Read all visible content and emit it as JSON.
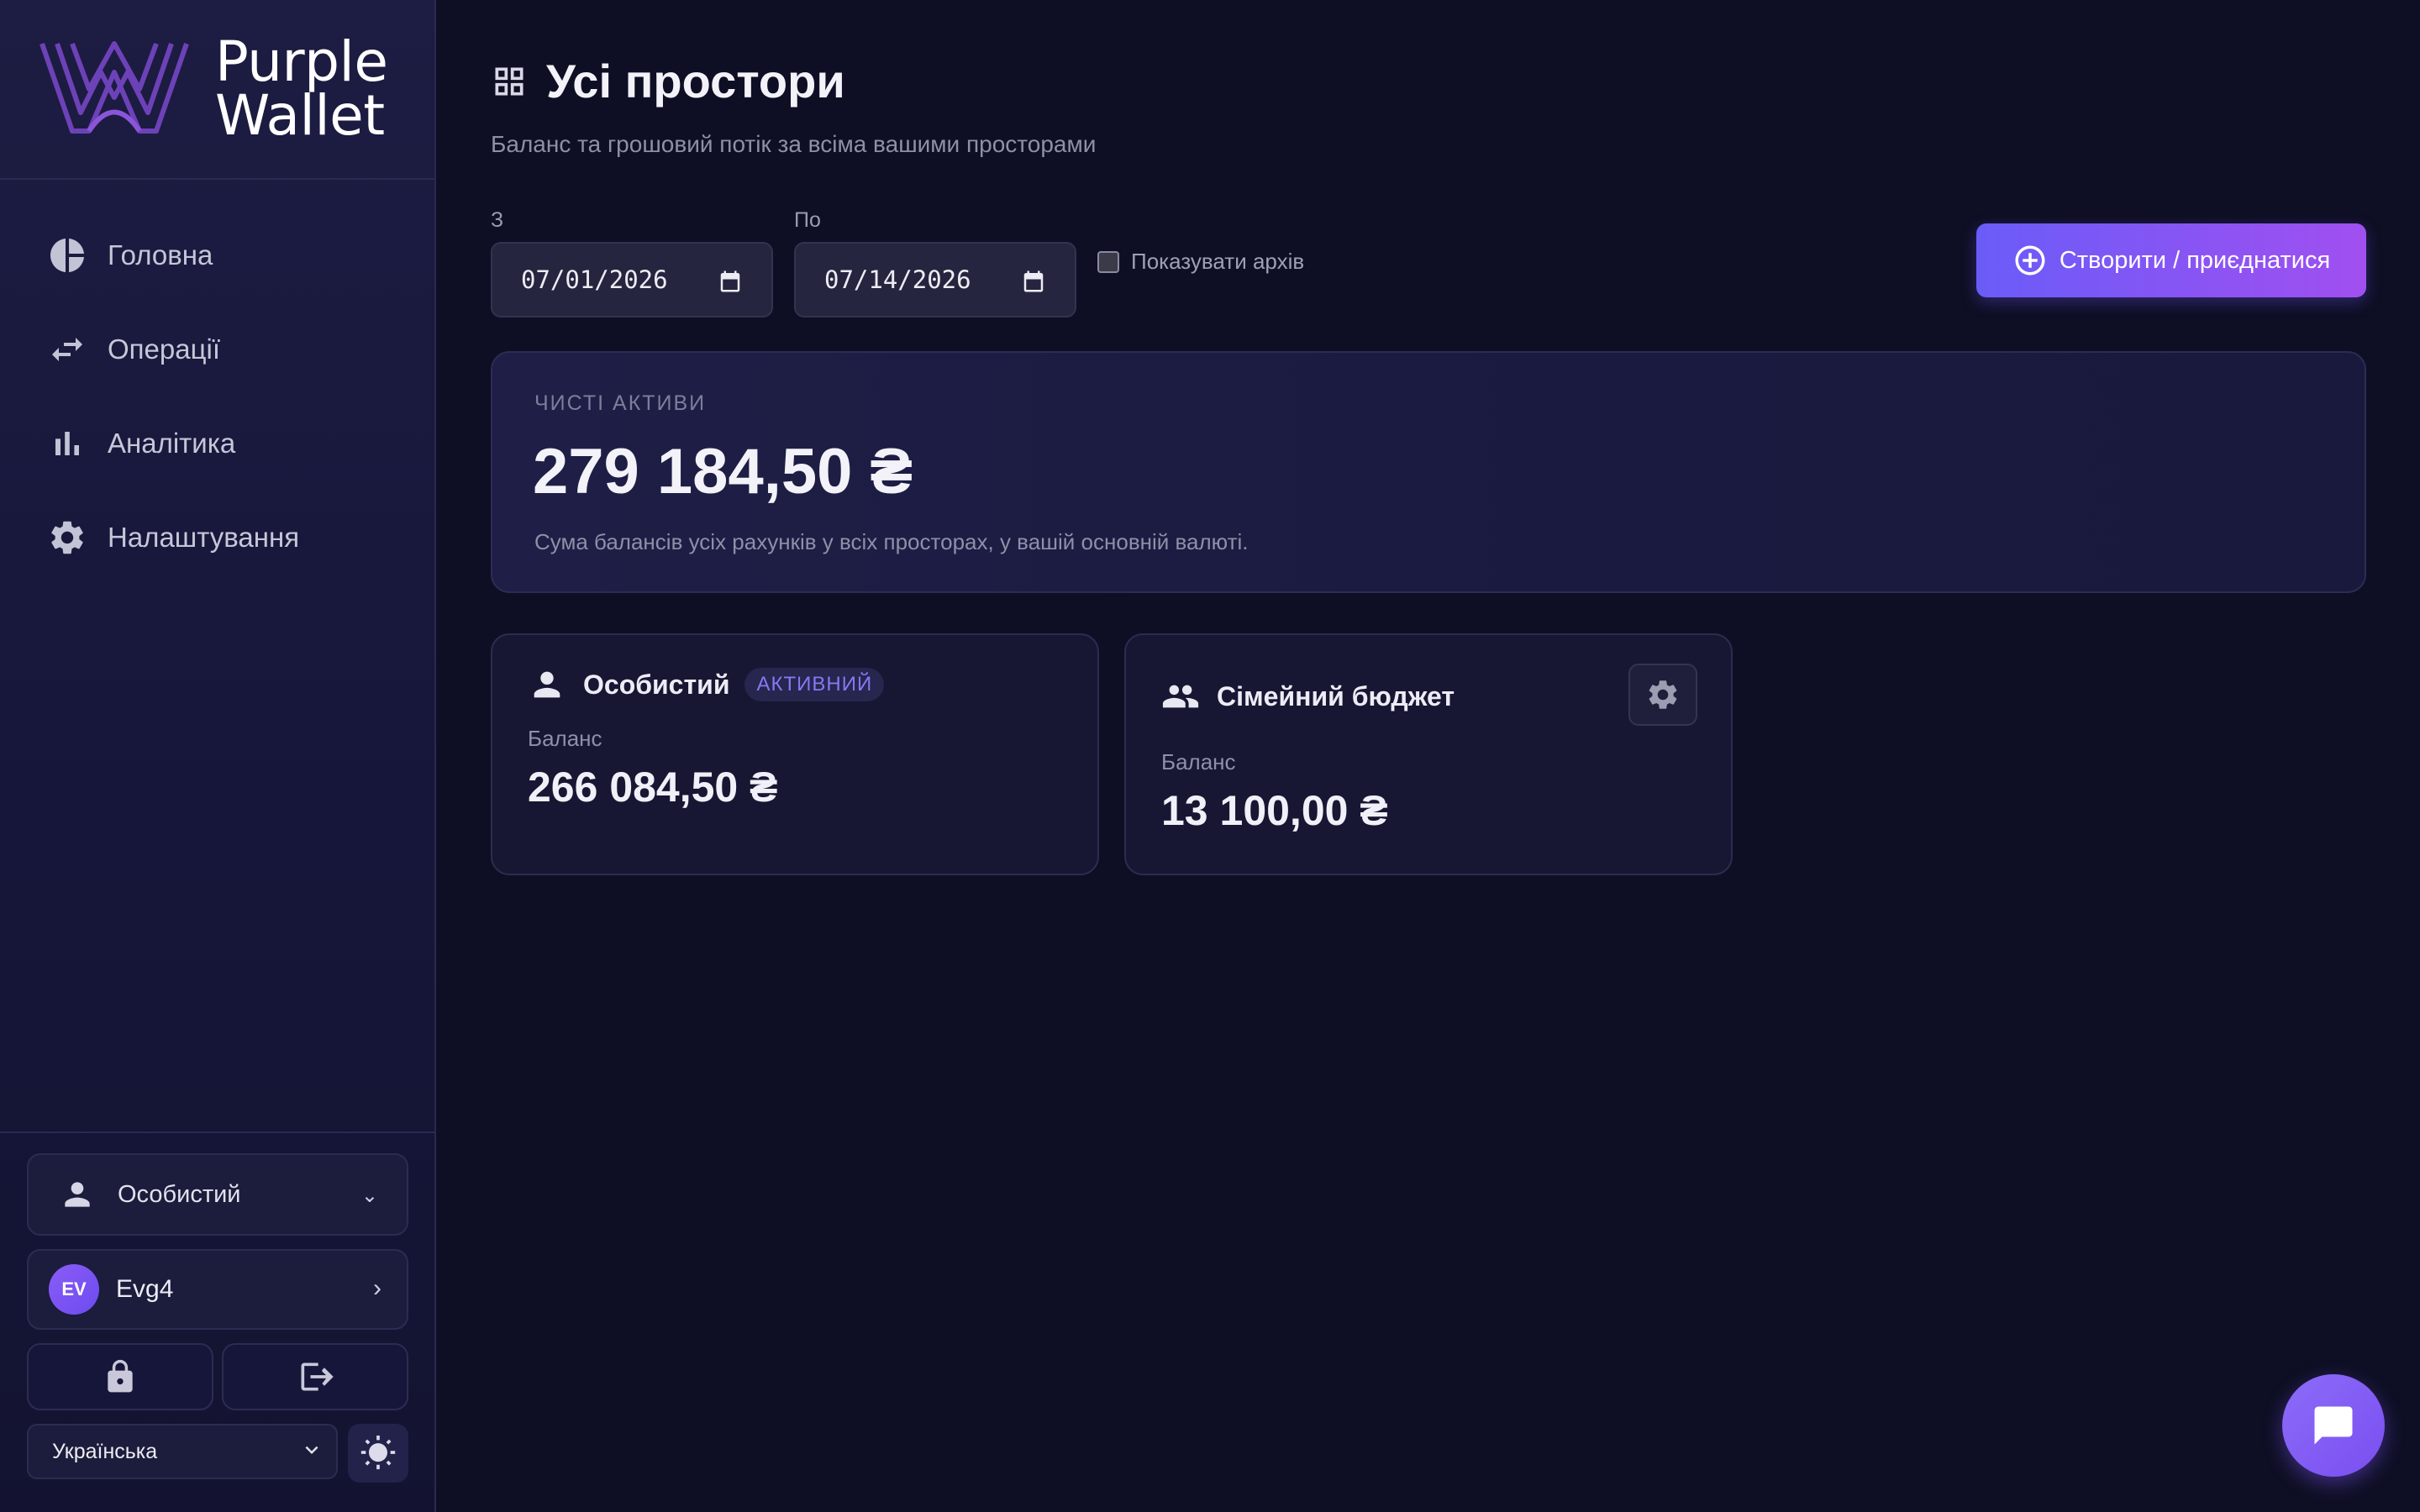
{
  "brand": {
    "name_line1": "Purple",
    "name_line2": "Wallet"
  },
  "sidebar": {
    "items": [
      {
        "label": "Головна",
        "icon": "pie-chart-icon"
      },
      {
        "label": "Операції",
        "icon": "swap-arrows-icon"
      },
      {
        "label": "Аналітика",
        "icon": "bar-chart-icon"
      },
      {
        "label": "Налаштування",
        "icon": "gear-icon"
      }
    ],
    "space_selector": {
      "label": "Особистий",
      "chevron": "⌄"
    },
    "user": {
      "initials": "EV",
      "name": "Evg4",
      "chevron": "›"
    },
    "language": "Українська"
  },
  "page": {
    "title": "Усі простори",
    "subtitle": "Баланс та грошовий потік за всіма вашими просторами"
  },
  "filters": {
    "from_label": "З",
    "from_value": "07/01/2026",
    "to_label": "По",
    "to_value": "07/14/2026",
    "archive_label": "Показувати архів",
    "archive_checked": false
  },
  "actions": {
    "create_join": "Створити / приєднатися"
  },
  "net_assets": {
    "caption": "ЧИСТІ АКТИВИ",
    "amount": "279 184,50 ₴",
    "note": "Сума балансів усіх рахунків у всіх просторах, у вашій основній валюті."
  },
  "spaces": [
    {
      "name": "Особистий",
      "badge": "АКТИВНИЙ",
      "balance_label": "Баланс",
      "balance": "266 084,50 ₴",
      "icon": "person-icon"
    },
    {
      "name": "Сімейний бюджет",
      "badge": "",
      "balance_label": "Баланс",
      "balance": "13 100,00 ₴",
      "icon": "group-icon"
    }
  ],
  "colors": {
    "accent_start": "#6a5cf8",
    "accent_end": "#a14ff0",
    "background": "#0e0f24",
    "sidebar": "#1d1c42"
  }
}
